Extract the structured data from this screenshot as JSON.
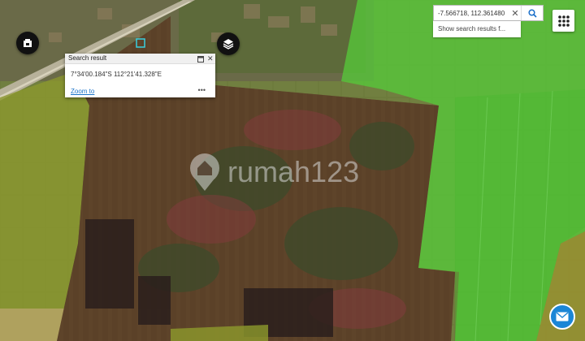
{
  "search": {
    "value": "-7.566718, 112.361480",
    "suggestion": "Show search results f..."
  },
  "popup": {
    "title": "Search result",
    "coordinates": "7°34'00.184\"S 112°21'41.328\"E",
    "zoom_link": "Zoom to",
    "more_label": "•••"
  },
  "watermark": "rumah123",
  "icons": {
    "basemap_gallery": "basemap-icon",
    "layers": "layers-icon",
    "apps_grid": "apps-grid-icon",
    "mail": "mail-icon",
    "search": "search-icon",
    "clear": "close-icon"
  },
  "colors": {
    "parcel_red": "#7a1a1a",
    "parcel_green": "#5fbf3a",
    "parcel_olive": "#8a8a22",
    "accent_blue": "#1b86d6"
  }
}
